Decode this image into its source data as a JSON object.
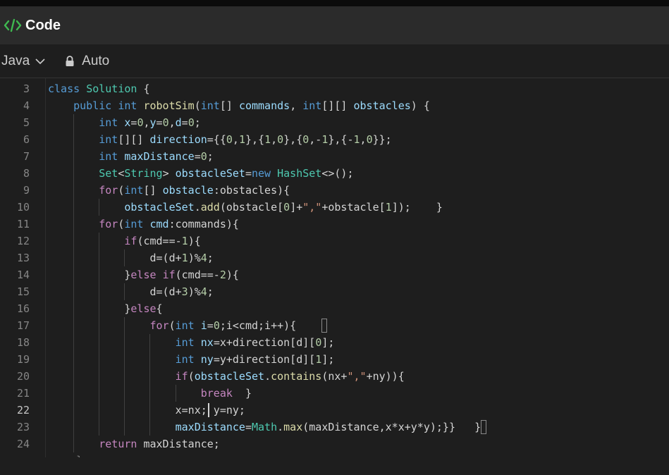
{
  "header": {
    "title": "Code",
    "icon": "code-brackets-icon"
  },
  "toolbar": {
    "language": "Java",
    "mode": "Auto"
  },
  "editor": {
    "active_line": "22",
    "lines": [
      {
        "num": "3",
        "tokens": [
          [
            "class ",
            "kw"
          ],
          [
            "Solution",
            "ty"
          ],
          [
            " {",
            ""
          ]
        ]
      },
      {
        "num": "4",
        "tokens": [
          [
            "    ",
            ""
          ],
          [
            "public ",
            "kw"
          ],
          [
            "int ",
            "kw"
          ],
          [
            "robotSim",
            "fn"
          ],
          [
            "(",
            ""
          ],
          [
            "int",
            "kw"
          ],
          [
            "[] ",
            ""
          ],
          [
            "commands",
            "var"
          ],
          [
            ", ",
            ""
          ],
          [
            "int",
            "kw"
          ],
          [
            "[][] ",
            ""
          ],
          [
            "obstacles",
            "var"
          ],
          [
            ") {",
            ""
          ]
        ]
      },
      {
        "num": "5",
        "tokens": [
          [
            "        ",
            ""
          ],
          [
            "int ",
            "kw"
          ],
          [
            "x",
            "var"
          ],
          [
            "=",
            ""
          ],
          [
            "0",
            "num"
          ],
          [
            ",",
            ""
          ],
          [
            "y",
            "var"
          ],
          [
            "=",
            ""
          ],
          [
            "0",
            "num"
          ],
          [
            ",",
            ""
          ],
          [
            "d",
            "var"
          ],
          [
            "=",
            ""
          ],
          [
            "0",
            "num"
          ],
          [
            ";",
            ""
          ]
        ]
      },
      {
        "num": "6",
        "tokens": [
          [
            "        ",
            ""
          ],
          [
            "int",
            "kw"
          ],
          [
            "[][] ",
            ""
          ],
          [
            "direction",
            "var"
          ],
          [
            "={{",
            ""
          ],
          [
            "0",
            "num"
          ],
          [
            ",",
            ""
          ],
          [
            "1",
            "num"
          ],
          [
            "},{",
            ""
          ],
          [
            "1",
            "num"
          ],
          [
            ",",
            ""
          ],
          [
            "0",
            "num"
          ],
          [
            "},{",
            ""
          ],
          [
            "0",
            "num"
          ],
          [
            ",-",
            ""
          ],
          [
            "1",
            "num"
          ],
          [
            "},{-",
            ""
          ],
          [
            "1",
            "num"
          ],
          [
            ",",
            ""
          ],
          [
            "0",
            "num"
          ],
          [
            "}};",
            ""
          ]
        ]
      },
      {
        "num": "7",
        "tokens": [
          [
            "        ",
            ""
          ],
          [
            "int ",
            "kw"
          ],
          [
            "maxDistance",
            "var"
          ],
          [
            "=",
            ""
          ],
          [
            "0",
            "num"
          ],
          [
            ";",
            ""
          ]
        ]
      },
      {
        "num": "8",
        "tokens": [
          [
            "        ",
            ""
          ],
          [
            "Set",
            "ty"
          ],
          [
            "<",
            ""
          ],
          [
            "String",
            "ty"
          ],
          [
            "> ",
            ""
          ],
          [
            "obstacleSet",
            "var"
          ],
          [
            "=",
            ""
          ],
          [
            "new ",
            "kw"
          ],
          [
            "HashSet",
            "ty"
          ],
          [
            "<>();",
            ""
          ]
        ]
      },
      {
        "num": "9",
        "tokens": [
          [
            "        ",
            ""
          ],
          [
            "for",
            "ctl"
          ],
          [
            "(",
            ""
          ],
          [
            "int",
            "kw"
          ],
          [
            "[] ",
            ""
          ],
          [
            "obstacle",
            "var"
          ],
          [
            ":obstacles){",
            ""
          ]
        ]
      },
      {
        "num": "10",
        "tokens": [
          [
            "            ",
            ""
          ],
          [
            "obstacleSet",
            "var"
          ],
          [
            ".",
            ""
          ],
          [
            "add",
            "fn"
          ],
          [
            "(obstacle[",
            ""
          ],
          [
            "0",
            "num"
          ],
          [
            "]+",
            ""
          ],
          [
            "\",\"",
            "str"
          ],
          [
            "+obstacle[",
            ""
          ],
          [
            "1",
            "num"
          ],
          [
            "]);    }",
            ""
          ]
        ]
      },
      {
        "num": "11",
        "tokens": [
          [
            "        ",
            ""
          ],
          [
            "for",
            "ctl"
          ],
          [
            "(",
            ""
          ],
          [
            "int ",
            "kw"
          ],
          [
            "cmd",
            "var"
          ],
          [
            ":commands){",
            ""
          ]
        ]
      },
      {
        "num": "12",
        "tokens": [
          [
            "            ",
            ""
          ],
          [
            "if",
            "ctl"
          ],
          [
            "(cmd==-",
            ""
          ],
          [
            "1",
            "num"
          ],
          [
            "){",
            ""
          ]
        ]
      },
      {
        "num": "13",
        "tokens": [
          [
            "                ",
            ""
          ],
          [
            "d=(d+",
            ""
          ],
          [
            "1",
            "num"
          ],
          [
            ")%",
            ""
          ],
          [
            "4",
            "num"
          ],
          [
            ";",
            ""
          ]
        ]
      },
      {
        "num": "14",
        "tokens": [
          [
            "            }",
            ""
          ],
          [
            "else ",
            "ctl"
          ],
          [
            "if",
            "ctl"
          ],
          [
            "(cmd==-",
            ""
          ],
          [
            "2",
            "num"
          ],
          [
            "){",
            ""
          ]
        ]
      },
      {
        "num": "15",
        "tokens": [
          [
            "                ",
            ""
          ],
          [
            "d=(d+",
            ""
          ],
          [
            "3",
            "num"
          ],
          [
            ")%",
            ""
          ],
          [
            "4",
            "num"
          ],
          [
            ";",
            ""
          ]
        ]
      },
      {
        "num": "16",
        "tokens": [
          [
            "            }",
            ""
          ],
          [
            "else",
            "ctl"
          ],
          [
            "{",
            ""
          ]
        ]
      },
      {
        "num": "17",
        "tokens": [
          [
            "                ",
            ""
          ],
          [
            "for",
            "ctl"
          ],
          [
            "(",
            ""
          ],
          [
            "int ",
            "kw"
          ],
          [
            "i",
            "var"
          ],
          [
            "=",
            ""
          ],
          [
            "0",
            "num"
          ],
          [
            ";i<cmd;i++){",
            ""
          ]
        ]
      },
      {
        "num": "18",
        "tokens": [
          [
            "                    ",
            ""
          ],
          [
            "int ",
            "kw"
          ],
          [
            "nx",
            "var"
          ],
          [
            "=x+direction[d][",
            ""
          ],
          [
            "0",
            "num"
          ],
          [
            "];",
            ""
          ]
        ]
      },
      {
        "num": "19",
        "tokens": [
          [
            "                    ",
            ""
          ],
          [
            "int ",
            "kw"
          ],
          [
            "ny",
            "var"
          ],
          [
            "=y+direction[d][",
            ""
          ],
          [
            "1",
            "num"
          ],
          [
            "];",
            ""
          ]
        ]
      },
      {
        "num": "20",
        "tokens": [
          [
            "                    ",
            ""
          ],
          [
            "if",
            "ctl"
          ],
          [
            "(",
            ""
          ],
          [
            "obstacleSet",
            "var"
          ],
          [
            ".",
            ""
          ],
          [
            "contains",
            "fn"
          ],
          [
            "(nx+",
            ""
          ],
          [
            "\",\"",
            "str"
          ],
          [
            "+ny)){",
            ""
          ]
        ]
      },
      {
        "num": "21",
        "tokens": [
          [
            "                        ",
            ""
          ],
          [
            "break",
            "ctl"
          ],
          [
            "  }",
            ""
          ]
        ]
      },
      {
        "num": "22",
        "tokens": [
          [
            "                    ",
            ""
          ],
          [
            "x=nx; y=ny;",
            ""
          ]
        ]
      },
      {
        "num": "23",
        "tokens": [
          [
            "                    ",
            ""
          ],
          [
            "maxDistance",
            "var"
          ],
          [
            "=",
            ""
          ],
          [
            "Math",
            "ty"
          ],
          [
            ".",
            ""
          ],
          [
            "max",
            "fn"
          ],
          [
            "(maxDistance,x*x+y*y);}}   }",
            ""
          ]
        ]
      },
      {
        "num": "24",
        "tokens": [
          [
            "        ",
            ""
          ],
          [
            "return ",
            "ctl"
          ],
          [
            "maxDistance;",
            ""
          ]
        ]
      }
    ]
  }
}
